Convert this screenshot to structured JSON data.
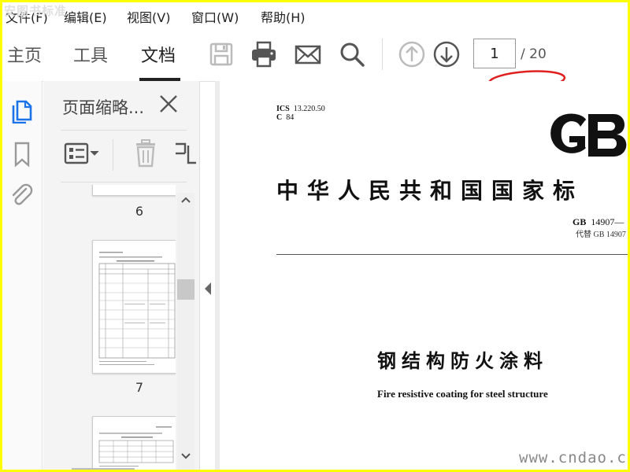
{
  "menubar": {
    "items": [
      {
        "label": "文件(F)"
      },
      {
        "label": "编辑(E)"
      },
      {
        "label": "视图(V)"
      },
      {
        "label": "窗口(W)"
      },
      {
        "label": "帮助(H)"
      }
    ],
    "watermark": "安图书标准"
  },
  "toolbar": {
    "tabs": [
      {
        "label": "主页",
        "active": false
      },
      {
        "label": "工具",
        "active": false
      },
      {
        "label": "文档",
        "active": true
      }
    ],
    "icons": [
      "save-icon",
      "print-icon",
      "email-icon",
      "search-icon",
      "prev-page-icon",
      "next-page-icon"
    ],
    "page_current": "1",
    "page_total": "/ 20",
    "highlight_color": "#e02020"
  },
  "sidebar_rail": {
    "icons": [
      "page-thumbnails-icon",
      "bookmark-icon",
      "attachment-icon"
    ],
    "active_color": "#1a73e8"
  },
  "thumbnails_panel": {
    "title": "页面缩略...",
    "pages": [
      {
        "number": "6"
      },
      {
        "number": "7"
      }
    ]
  },
  "document": {
    "ics_label": "ICS",
    "ics_value": "13.220.50",
    "ccs_label": "C",
    "ccs_value": "84",
    "logo_text": "GB",
    "standard_title": "中华人民共和国国家标",
    "gb_label": "GB",
    "gb_number": "14907—",
    "replaces": "代替 GB 14907",
    "title_zh": "钢结构防火涂料",
    "title_en": "Fire resistive coating for steel structure"
  },
  "watermark_br": "www.cndao.com",
  "colors": {
    "frame_border": "#ffff00",
    "accent": "#1a73e8"
  }
}
